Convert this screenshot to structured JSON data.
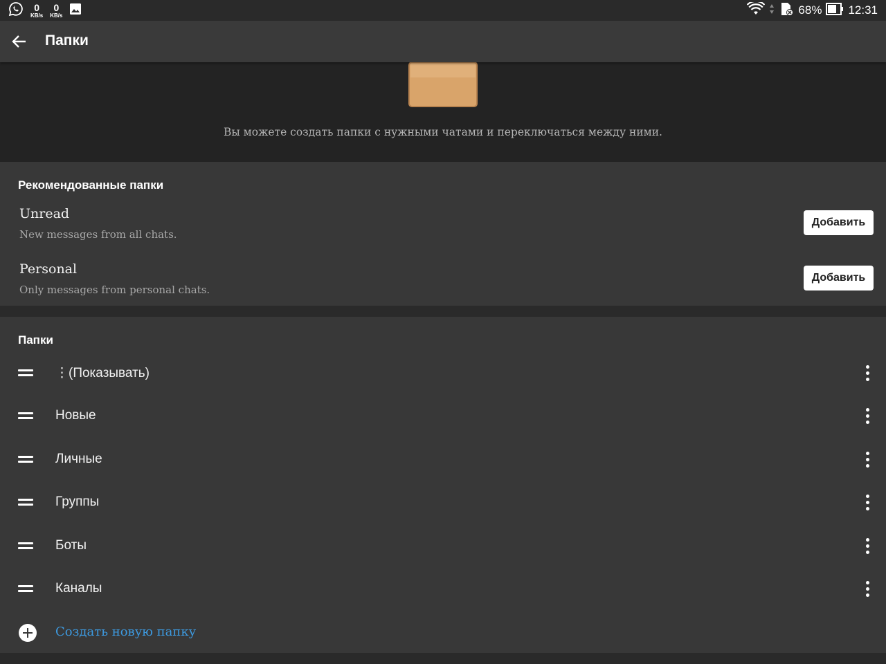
{
  "status_bar": {
    "left_icons": [
      "whatsapp-icon",
      "image-icon"
    ],
    "net_rates": [
      {
        "value": "0",
        "unit": "KB/s"
      },
      {
        "value": "0",
        "unit": "KB/s"
      }
    ],
    "right_icons": [
      "wifi-icon",
      "sd-card-icon",
      "battery-icon"
    ],
    "battery_percent": "68%",
    "time": "12:31"
  },
  "toolbar": {
    "title": "Папки"
  },
  "hero": {
    "description": "Вы можете создать папки с нужными чатами и переключаться между ними."
  },
  "recommended": {
    "header": "Рекомендованные папки",
    "items": [
      {
        "title": "Unread",
        "subtitle": "New messages from all chats.",
        "button": "Добавить"
      },
      {
        "title": "Personal",
        "subtitle": "Only messages from personal chats.",
        "button": "Добавить"
      }
    ]
  },
  "folders": {
    "header": "Папки",
    "items": [
      {
        "name": "⋮(Показывать)"
      },
      {
        "name": "Новые"
      },
      {
        "name": "Личные"
      },
      {
        "name": "Группы"
      },
      {
        "name": "Боты"
      },
      {
        "name": "Каналы"
      }
    ],
    "create_label": "Создать новую папку"
  },
  "colors": {
    "background": "#232323",
    "section": "#383838",
    "toolbar": "#3a3a3a",
    "accent_link": "#3d9ae0"
  }
}
